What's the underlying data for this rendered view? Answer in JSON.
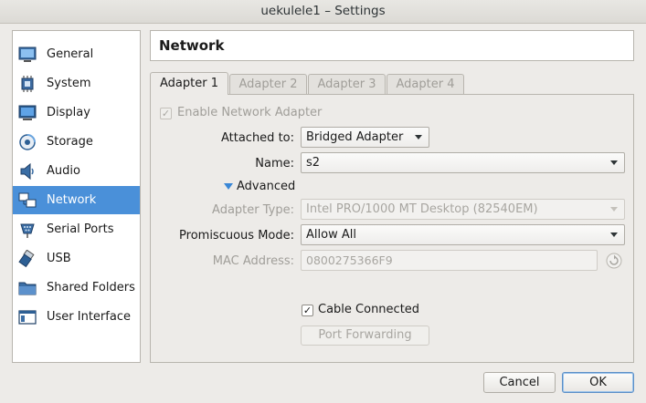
{
  "window": {
    "title": "uekulele1 – Settings"
  },
  "sidebar": {
    "items": [
      {
        "label": "General",
        "icon": "monitor-icon"
      },
      {
        "label": "System",
        "icon": "chip-icon"
      },
      {
        "label": "Display",
        "icon": "display-icon"
      },
      {
        "label": "Storage",
        "icon": "storage-disc-icon"
      },
      {
        "label": "Audio",
        "icon": "speaker-icon"
      },
      {
        "label": "Network",
        "icon": "network-icon",
        "selected": true
      },
      {
        "label": "Serial Ports",
        "icon": "serial-port-icon"
      },
      {
        "label": "USB",
        "icon": "usb-icon"
      },
      {
        "label": "Shared Folders",
        "icon": "folder-icon"
      },
      {
        "label": "User Interface",
        "icon": "window-icon"
      }
    ]
  },
  "header": {
    "title": "Network"
  },
  "tabs": [
    {
      "label": "Adapter 1",
      "active": true
    },
    {
      "label": "Adapter 2",
      "active": false
    },
    {
      "label": "Adapter 3",
      "active": false
    },
    {
      "label": "Adapter 4",
      "active": false
    }
  ],
  "adapter": {
    "enable_label": "Enable Network Adapter",
    "enabled": true,
    "attached_to_label": "Attached to:",
    "attached_to_value": "Bridged Adapter",
    "name_label": "Name:",
    "name_value": "s2",
    "advanced_label": "Advanced",
    "adapter_type_label": "Adapter Type:",
    "adapter_type_value": "Intel PRO/1000 MT Desktop (82540EM)",
    "promiscuous_label": "Promiscuous Mode:",
    "promiscuous_value": "Allow All",
    "mac_label": "MAC Address:",
    "mac_value": "0800275366F9",
    "cable_label": "Cable Connected",
    "cable_connected": true,
    "port_forwarding_label": "Port Forwarding"
  },
  "footer": {
    "cancel_label": "Cancel",
    "ok_label": "OK"
  },
  "colors": {
    "selection": "#4a90d9",
    "accent_triangle": "#3a87d6"
  }
}
